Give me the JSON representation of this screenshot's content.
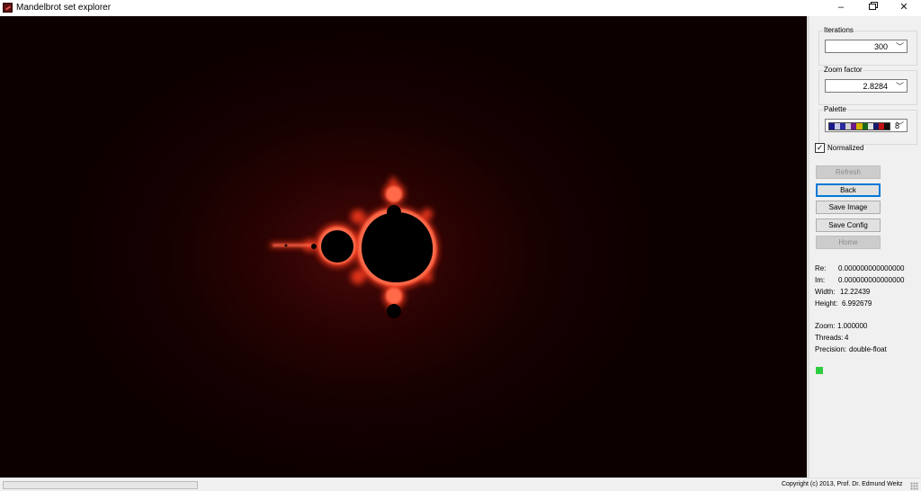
{
  "window": {
    "title": "Mandelbrot set explorer",
    "icon": "mandelbrot-app-icon",
    "controls": {
      "minimize": "–",
      "restore": "restore-icon",
      "close": "✕"
    }
  },
  "colors": {
    "fractal_glow": "#ff3b1f",
    "fractal_core": "#000000",
    "background_dark": "#0d0000",
    "status_ok": "#2ecc40"
  },
  "panel": {
    "iterations": {
      "label": "Iterations",
      "value": "300"
    },
    "zoom_factor": {
      "label": "Zoom factor",
      "value": "2.8284"
    },
    "palette": {
      "label": "Palette",
      "value": "8",
      "swatch_colors": [
        "#1a1a8c",
        "#c8c8e8",
        "#2a2aa0",
        "#d0d0d0",
        "#6a1a8a",
        "#d8b000",
        "#1a6a1a",
        "#e0e0e0",
        "#1a1a6a",
        "#c01010",
        "#101010"
      ]
    },
    "normalized": {
      "label": "Normalized",
      "checked": true,
      "mark": "✓"
    },
    "buttons": {
      "refresh": {
        "label": "Refresh",
        "enabled": false
      },
      "back": {
        "label": "Back",
        "enabled": true
      },
      "save_image": {
        "label": "Save Image",
        "enabled": true
      },
      "save_config": {
        "label": "Save Config",
        "enabled": true
      },
      "home": {
        "label": "Home",
        "enabled": false
      }
    },
    "info": {
      "re_label": "Re:",
      "re_value": "0.000000000000000",
      "im_label": "Im:",
      "im_value": "0.000000000000000",
      "width_label": "Width:",
      "width_value": "12.22439",
      "height_label": "Height:",
      "height_value": "6.992679",
      "zoom_label": "Zoom:",
      "zoom_value": "1.000000",
      "threads_label": "Threads:",
      "threads_value": "4",
      "precision_label": "Precision:",
      "precision_value": "double-float"
    }
  },
  "statusbar": {
    "progress": 0,
    "copyright": "Copyright (c) 2013, Prof. Dr. Edmund Weitz"
  }
}
